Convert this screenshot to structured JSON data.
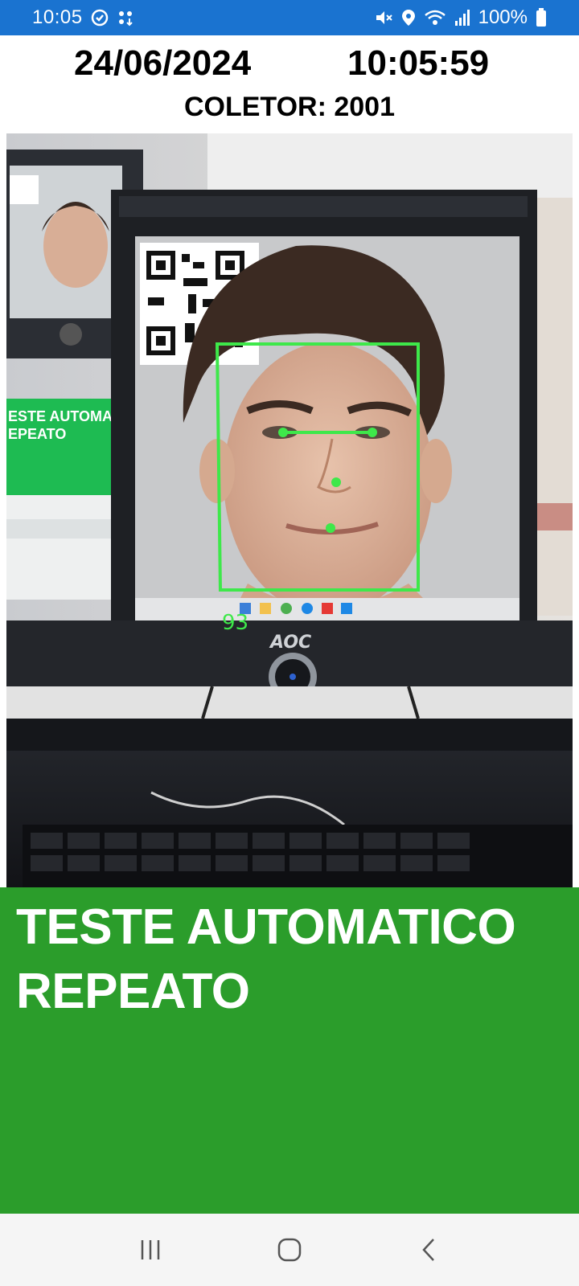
{
  "status_bar": {
    "time": "10:05",
    "battery": "100%",
    "icons": [
      "sync-icon",
      "transfer-icon",
      "mute-icon",
      "location-icon",
      "wifi-icon",
      "signal-icon",
      "battery-icon"
    ]
  },
  "header": {
    "date": "24/06/2024",
    "clock": "10:05:59",
    "collector": "COLETOR: 2001"
  },
  "camera": {
    "match_score": "93",
    "overlay_color": "#3ee84a"
  },
  "message": {
    "line1": "TESTE AUTOMATICO",
    "line2": "REPEATO",
    "background": "#2b9d2b"
  },
  "nav_bar": {
    "buttons": [
      "recent-apps-icon",
      "home-icon",
      "back-icon"
    ]
  },
  "colors": {
    "status_bar": "#1a73d0",
    "text": "#000000"
  }
}
